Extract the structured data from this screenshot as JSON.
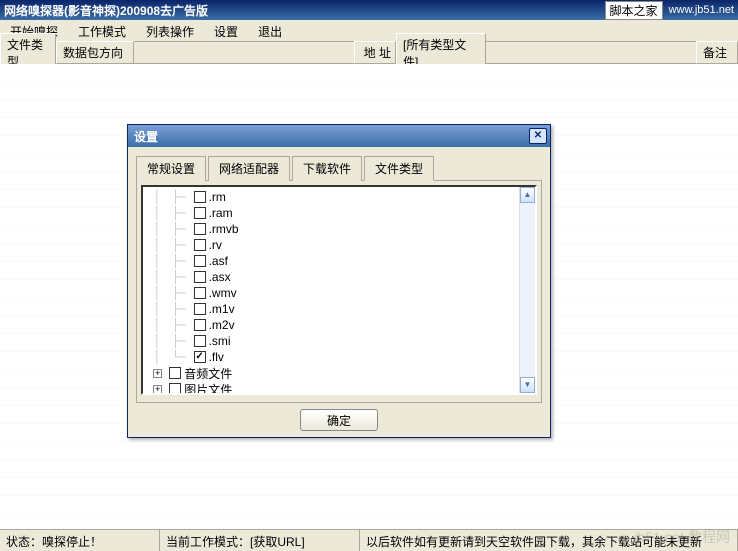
{
  "titlebar": {
    "text": "网络嗅探器(影音神探)200908去广告版",
    "site_label": "脚本之家",
    "site_url": "www.jb51.net"
  },
  "menu": {
    "start": "开始嗅探",
    "mode": "工作模式",
    "listop": "列表操作",
    "settings": "设置",
    "exit": "退出"
  },
  "columns": {
    "filetype": "文件类型",
    "direction": "数据包方向",
    "addr_label": "地  址",
    "addr_value": "[所有类型文件]",
    "remark": "备注"
  },
  "dialog": {
    "title": "设置",
    "tabs": {
      "general": "常规设置",
      "adapter": "网络适配器",
      "download": "下载软件",
      "filetype": "文件类型"
    },
    "ext_items": [
      {
        "label": ".rm",
        "checked": false
      },
      {
        "label": ".ram",
        "checked": false
      },
      {
        "label": ".rmvb",
        "checked": false
      },
      {
        "label": ".rv",
        "checked": false
      },
      {
        "label": ".asf",
        "checked": false
      },
      {
        "label": ".asx",
        "checked": false
      },
      {
        "label": ".wmv",
        "checked": false
      },
      {
        "label": ".m1v",
        "checked": false
      },
      {
        "label": ".m2v",
        "checked": false
      },
      {
        "label": ".smi",
        "checked": false
      },
      {
        "label": ".flv",
        "checked": true
      }
    ],
    "groups": {
      "audio": "音频文件",
      "image": "图片文件"
    },
    "ok": "确定"
  },
  "status": {
    "left": "状态：嗅探停止！",
    "mid": "当前工作模式：[获取URL]",
    "right": "以后软件如有更新请到天空软件园下载，其余下载站可能未更新"
  },
  "watermark": "jb51.net 教程网"
}
